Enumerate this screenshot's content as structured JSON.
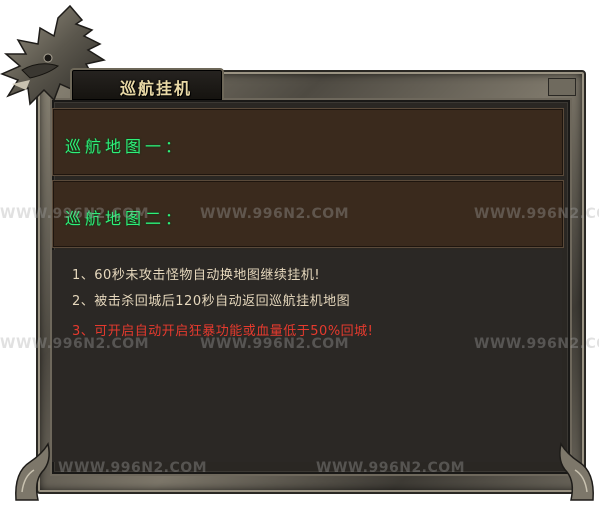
{
  "panel": {
    "title": "巡航挂机"
  },
  "maps": [
    {
      "label": "巡航地图一："
    },
    {
      "label": "巡航地图二："
    }
  ],
  "info_lines": [
    {
      "text": "1、60秒未攻击怪物自动换地图继续挂机!",
      "color": "#e6d8bd"
    },
    {
      "text": "2、被击杀回城后120秒自动返回巡航挂机地图",
      "color": "#e6d8bd"
    },
    {
      "text": "3、可开启自动开启狂暴功能或血量低于50%回城!",
      "color": "#e63a2e"
    }
  ],
  "watermark": {
    "text": "WWW.996N2.COM"
  },
  "colors": {
    "map_label": "#2ef07a",
    "title": "#e9d9a6",
    "warning": "#e63a2e"
  },
  "icons": [
    "dragon-head-icon",
    "corner-ornament-icon"
  ]
}
